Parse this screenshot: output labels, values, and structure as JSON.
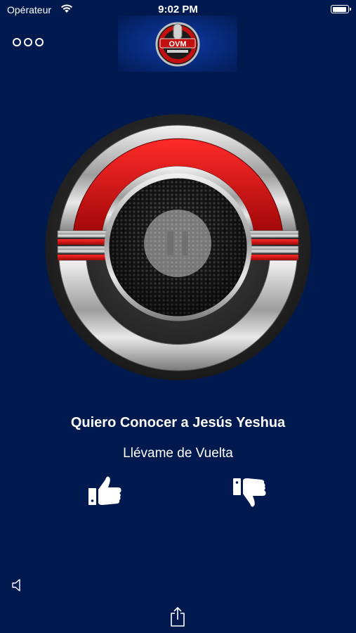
{
  "status_bar": {
    "carrier": "Opérateur",
    "time": "9:02 PM",
    "battery_level": 0.95
  },
  "header": {
    "logo": {
      "name": "station-logo",
      "text": "OVM"
    },
    "menu_icon": "more-circles-icon"
  },
  "player": {
    "state": "playing",
    "control_icon": "pause-icon",
    "colors": {
      "ring_red": "#d40d0d",
      "chrome": "#c9c9c9",
      "grille": "#2a2a2a"
    }
  },
  "now_playing": {
    "title": "Quiero Conocer a Jesús Yeshua",
    "artist": "Llévame de Vuelta"
  },
  "actions": {
    "like_icon": "thumbs-up-icon",
    "dislike_icon": "thumbs-down-icon",
    "volume_icon": "speaker-icon",
    "share_icon": "share-icon"
  },
  "colors": {
    "background": "#001a4f",
    "text": "#ffffff"
  }
}
